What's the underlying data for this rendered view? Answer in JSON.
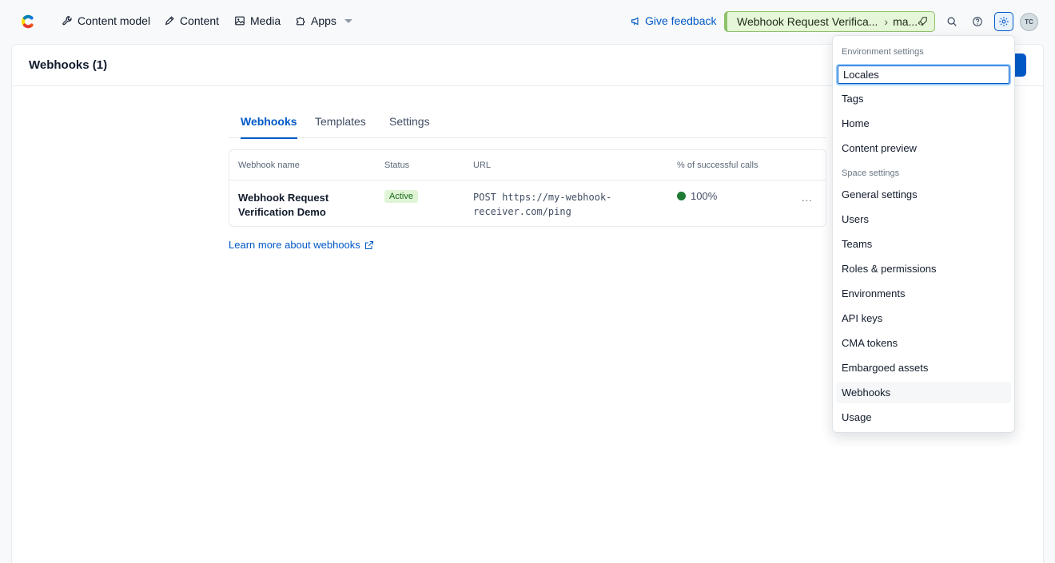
{
  "nav": {
    "items": [
      {
        "label": "Content model",
        "icon": "wrench-icon"
      },
      {
        "label": "Content",
        "icon": "pen-icon"
      },
      {
        "label": "Media",
        "icon": "image-icon"
      },
      {
        "label": "Apps",
        "icon": "puzzle-icon"
      }
    ],
    "feedback": "Give feedback",
    "env_space": "Webhook Request Verifica...",
    "env_name": "ma...",
    "avatar_initials": "TC"
  },
  "page": {
    "title": "Webhooks (1)"
  },
  "tabs": [
    "Webhooks",
    "Templates",
    "Settings"
  ],
  "table": {
    "headers": [
      "Webhook name",
      "Status",
      "URL",
      "% of successful calls"
    ],
    "rows": [
      {
        "name": "Webhook Request Verification Demo",
        "status": "Active",
        "url": "POST https://my-webhook-receiver.com/ping",
        "rate": "100%"
      }
    ],
    "more": "..."
  },
  "learn_more": "Learn more about webhooks",
  "dropdown": {
    "section_env": "Environment settings",
    "env_items": [
      "Locales",
      "Tags",
      "Home",
      "Content preview"
    ],
    "section_space": "Space settings",
    "space_items": [
      "General settings",
      "Users",
      "Teams",
      "Roles & permissions",
      "Environments",
      "API keys",
      "CMA tokens",
      "Embargoed assets",
      "Webhooks",
      "Usage"
    ]
  },
  "colors": {
    "primary": "#0059c8",
    "env_green": "#8dc26a",
    "active_badge": "#dff5d6",
    "success_dot": "#1f7a36"
  }
}
